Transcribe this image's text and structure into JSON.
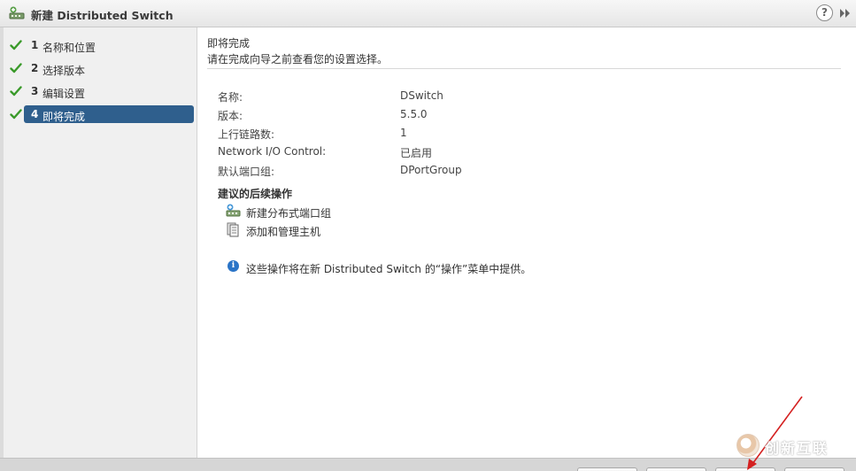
{
  "window": {
    "title": "新建 Distributed Switch",
    "help_label": "?"
  },
  "steps": [
    {
      "number": "1",
      "label": "名称和位置",
      "completed": true,
      "active": false
    },
    {
      "number": "2",
      "label": "选择版本",
      "completed": true,
      "active": false
    },
    {
      "number": "3",
      "label": "编辑设置",
      "completed": true,
      "active": false
    },
    {
      "number": "4",
      "label": "即将完成",
      "completed": true,
      "active": true
    }
  ],
  "main": {
    "title": "即将完成",
    "subtitle": "请在完成向导之前查看您的设置选择。",
    "summary": [
      {
        "key": "名称:",
        "value": "DSwitch"
      },
      {
        "key": "版本:",
        "value": "5.5.0"
      },
      {
        "key": "上行链路数:",
        "value": "1"
      },
      {
        "key": "Network I/O Control:",
        "value": "已启用"
      },
      {
        "key": "默认端口组:",
        "value": "DPortGroup"
      }
    ],
    "next_steps_title": "建议的后续操作",
    "actions": [
      {
        "label": "新建分布式端口组",
        "icon": "new-portgroup-icon"
      },
      {
        "label": "添加和管理主机",
        "icon": "manage-hosts-icon"
      }
    ],
    "info_text": "这些操作将在新 Distributed Switch 的“操作”菜单中提供。"
  },
  "watermark": {
    "text": "创新互联"
  },
  "colors": {
    "active_step": "#2f5f8d",
    "check": "#3a9a2a",
    "info_icon": "#2a74c7",
    "annotation_arrow": "#d42020"
  }
}
